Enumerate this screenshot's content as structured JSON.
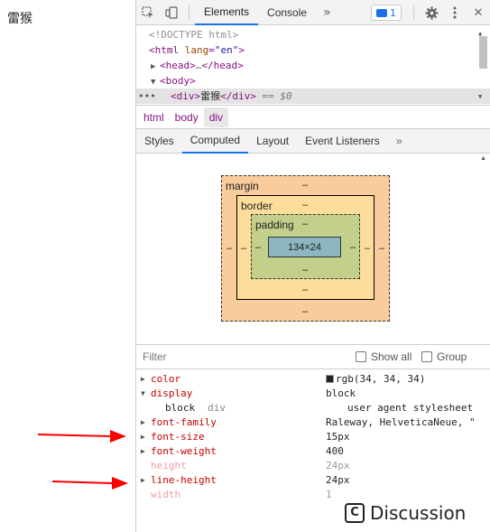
{
  "page": {
    "content_text": "雷猴"
  },
  "toolbar": {
    "tabs": [
      "Elements",
      "Console"
    ],
    "active_tab": "Elements",
    "more_label": "»",
    "issues_count": "1",
    "close_label": "✕"
  },
  "tree": {
    "doctype": "<!DOCTYPE html>",
    "html_open": "<html",
    "lang_attr": "lang",
    "lang_val": "\"en\"",
    "gt": ">",
    "head_open": "<head>",
    "head_ellipsis": "…",
    "head_close": "</head>",
    "body_open": "<body>",
    "div_open": "<div>",
    "div_text": "雷猴",
    "div_close": "</div>",
    "selected_marker": "== $0",
    "ellipsis": "•••"
  },
  "breadcrumb": [
    "html",
    "body",
    "div"
  ],
  "subtabs": [
    "Styles",
    "Computed",
    "Layout",
    "Event Listeners"
  ],
  "subtabs_more": "»",
  "box_model": {
    "margin_label": "margin",
    "border_label": "border",
    "padding_label": "padding",
    "content_size": "134×24",
    "dash": "–"
  },
  "filter": {
    "placeholder": "Filter",
    "show_all": "Show all",
    "group": "Group"
  },
  "computed": [
    {
      "name": "color",
      "value": "rgb(34, 34, 34)",
      "swatch": "#222222"
    },
    {
      "name": "display",
      "value": "block",
      "sub_value": "block",
      "sub_selector": "div",
      "sub_source": "user agent stylesheet"
    },
    {
      "name": "font-family",
      "value": "Raleway, HelveticaNeue, \""
    },
    {
      "name": "font-size",
      "value": "15px"
    },
    {
      "name": "font-weight",
      "value": "400"
    },
    {
      "name": "height",
      "value": "24px"
    },
    {
      "name": "line-height",
      "value": "24px"
    },
    {
      "name": "width",
      "value": "1"
    }
  ],
  "watermark": {
    "icon": "C",
    "text": "Discussion"
  },
  "colors": {
    "accent": "#1a73e8",
    "arrow": "#ff0000",
    "prop_name": "#c80000"
  }
}
